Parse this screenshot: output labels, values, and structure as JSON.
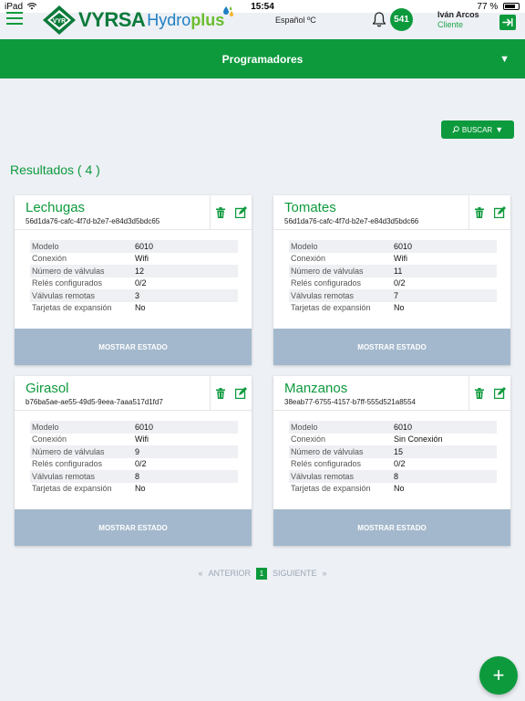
{
  "status_bar": {
    "device": "iPad",
    "time": "15:54",
    "battery": "77 %",
    "battery_level": 0.77
  },
  "header": {
    "logo_badge": "VYR",
    "logo_brand": "VYRSA",
    "logo_product": "Hydro",
    "logo_product_plus": "plus",
    "language": "Español ºC",
    "notifications_count": "541",
    "user_name": "Iván Arcos",
    "user_role": "Cliente"
  },
  "title_bar": {
    "title": "Programadores",
    "caret": "▼"
  },
  "search": {
    "label": "BUSCAR",
    "caret": "▼"
  },
  "results_label": "Resultados ( 4 )",
  "cards": [
    {
      "name": "Lechugas",
      "id": "56d1da76-cafc-4f7d-b2e7-e84d3d5bdc65",
      "specs": [
        {
          "label": "Modelo",
          "value": "6010"
        },
        {
          "label": "Conexión",
          "value": "Wifi"
        },
        {
          "label": "Número de válvulas",
          "value": "12"
        },
        {
          "label": "Relés configurados",
          "value": "0/2"
        },
        {
          "label": "Válvulas remotas",
          "value": "3"
        },
        {
          "label": "Tarjetas de expansión",
          "value": "No"
        }
      ],
      "button": "MOSTRAR ESTADO"
    },
    {
      "name": "Tomates",
      "id": "56d1da76-cafc-4f7d-b2e7-e84d3d5bdc66",
      "specs": [
        {
          "label": "Modelo",
          "value": "6010"
        },
        {
          "label": "Conexión",
          "value": "Wifi"
        },
        {
          "label": "Número de válvulas",
          "value": "11"
        },
        {
          "label": "Relés configurados",
          "value": "0/2"
        },
        {
          "label": "Válvulas remotas",
          "value": "7"
        },
        {
          "label": "Tarjetas de expansión",
          "value": "No"
        }
      ],
      "button": "MOSTRAR ESTADO"
    },
    {
      "name": "Girasol",
      "id": "b76ba5ae-ae55-49d5-9eea-7aaa517d1fd7",
      "specs": [
        {
          "label": "Modelo",
          "value": "6010"
        },
        {
          "label": "Conexión",
          "value": "Wifi"
        },
        {
          "label": "Número de válvulas",
          "value": "9"
        },
        {
          "label": "Relés configurados",
          "value": "0/2"
        },
        {
          "label": "Válvulas remotas",
          "value": "8"
        },
        {
          "label": "Tarjetas de expansión",
          "value": "No"
        }
      ],
      "button": "MOSTRAR ESTADO"
    },
    {
      "name": "Manzanos",
      "id": "38eab77-6755-4157-b7ff-555d521a8554",
      "specs": [
        {
          "label": "Modelo",
          "value": "6010"
        },
        {
          "label": "Conexión",
          "value": "Sin Conexión"
        },
        {
          "label": "Número de válvulas",
          "value": "15"
        },
        {
          "label": "Relés configurados",
          "value": "0/2"
        },
        {
          "label": "Válvulas remotas",
          "value": "8"
        },
        {
          "label": "Tarjetas de expansión",
          "value": "No"
        }
      ],
      "button": "MOSTRAR ESTADO"
    }
  ],
  "pagination": {
    "first": "«",
    "previous": "ANTERIOR",
    "current": "1",
    "next": "SIGUIENTE",
    "last": "»"
  },
  "fab_label": "+",
  "colors": {
    "primary": "#0d9a3d",
    "button_disabled": "#a3b8cc",
    "background": "#edf0f5"
  }
}
